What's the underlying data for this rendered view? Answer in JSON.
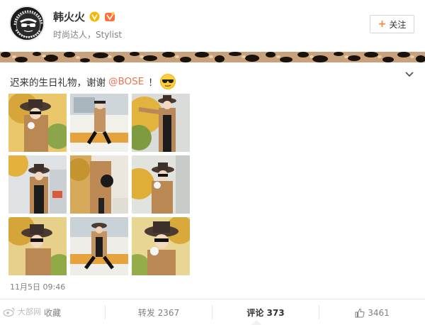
{
  "header": {
    "username": "韩火火",
    "subtitle": "时尚达人，Stylist",
    "follow_label": "关注",
    "follow_plus": "+"
  },
  "post": {
    "text": "迟来的生日礼物，谢谢",
    "mention": "@BOSE",
    "exclamation": "！",
    "timestamp": "11月5日 09:46",
    "photo_count": 9
  },
  "footer": {
    "favorite_label": "收藏",
    "repost_label": "转发 2367",
    "comment_label": "评论 373",
    "like_count": "3461"
  },
  "watermark": {
    "text": "大部网"
  },
  "icons": {
    "verified": "v-badge-icon",
    "member": "member-badge-icon",
    "emoji": "sunglasses-emoji-icon",
    "expand": "chevron-down-icon",
    "like": "thumbs-up-icon"
  },
  "colors": {
    "accent": "#eb7350",
    "follow_plus": "#ff8140",
    "verified": "#f9b600"
  }
}
